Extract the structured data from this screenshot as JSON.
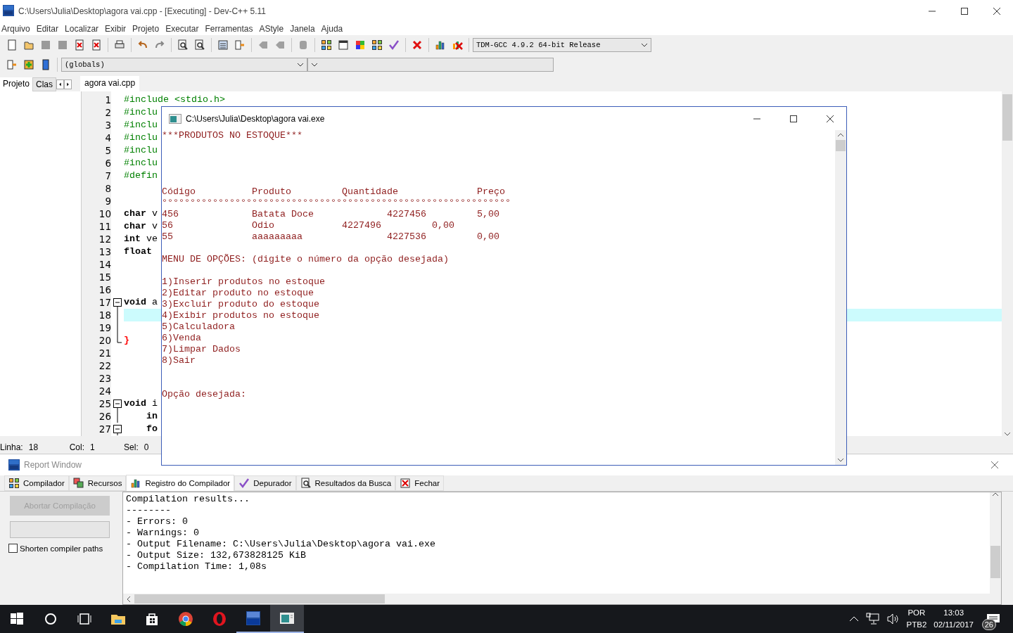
{
  "window": {
    "title": "C:\\Users\\Julia\\Desktop\\agora vai.cpp - [Executing] - Dev-C++ 5.11"
  },
  "menu": [
    "Arquivo",
    "Editar",
    "Localizar",
    "Exibir",
    "Projeto",
    "Executar",
    "Ferramentas",
    "AStyle",
    "Janela",
    "Ajuda"
  ],
  "toolbar": {
    "compiler": "TDM-GCC 4.9.2 64-bit Release",
    "scope": "(globals)"
  },
  "left_panel": {
    "tabs": [
      {
        "label": "Projeto",
        "selected": true
      },
      {
        "label": "Clas",
        "selected": false
      }
    ]
  },
  "editor": {
    "tabs": [
      {
        "label": "agora vai.cpp",
        "selected": true
      }
    ],
    "lines": [
      {
        "number": "1",
        "kind": "preprocessor",
        "text": "#include <stdio.h>",
        "current": false
      },
      {
        "number": "2",
        "kind": "preprocessor",
        "text": "#inclu",
        "current": false
      },
      {
        "number": "3",
        "kind": "preprocessor",
        "text": "#inclu",
        "current": false
      },
      {
        "number": "4",
        "kind": "preprocessor",
        "text": "#inclu",
        "current": false
      },
      {
        "number": "5",
        "kind": "preprocessor",
        "text": "#inclu",
        "current": false
      },
      {
        "number": "6",
        "kind": "preprocessor",
        "text": "#inclu",
        "current": false
      },
      {
        "number": "7",
        "kind": "preprocessor",
        "text": "#defin",
        "current": false
      },
      {
        "number": "8",
        "current": false
      },
      {
        "number": "9",
        "current": false
      },
      {
        "number": "10",
        "kind": "code",
        "text": "**char** v",
        "current": false
      },
      {
        "number": "11",
        "kind": "code",
        "text": "**char** v",
        "current": false
      },
      {
        "number": "12",
        "kind": "code",
        "text": "**int** ve",
        "current": false
      },
      {
        "number": "13",
        "kind": "keyword",
        "text": "float",
        "current": false
      },
      {
        "number": "14",
        "current": false
      },
      {
        "number": "15",
        "current": false
      },
      {
        "number": "16",
        "current": false
      },
      {
        "number": "17",
        "kind": "code",
        "text": "**void** a",
        "collapsible": true,
        "current": false
      },
      {
        "number": "18",
        "in_block": true,
        "current": true
      },
      {
        "number": "19",
        "in_block": true,
        "current": false
      },
      {
        "number": "20",
        "kind": "brace",
        "text": "}",
        "in_block": true,
        "current": false
      },
      {
        "number": "21",
        "current": false
      },
      {
        "number": "22",
        "current": false
      },
      {
        "number": "23",
        "current": false
      },
      {
        "number": "24",
        "current": false
      },
      {
        "number": "25",
        "kind": "code",
        "text": "**void** i",
        "collapsible": true,
        "current": false
      },
      {
        "number": "26",
        "kind": "keyword",
        "text": "    in",
        "in_block": true,
        "current": false
      },
      {
        "number": "27",
        "kind": "keyword",
        "text": "    fo",
        "collapsible": true,
        "current": false
      }
    ]
  },
  "status_bar": {
    "line_label": "Linha:",
    "line": "18",
    "col_label": "Col:",
    "col": "1",
    "sel_label": "Sel:",
    "sel": "0"
  },
  "console": {
    "title": "C:\\Users\\Julia\\Desktop\\agora vai.exe",
    "heading": "***PRODUTOS NO ESTOQUE***",
    "table_header": "Código          Produto         Quantidade              Preço",
    "table_rule": "°°°°°°°°°°°°°°°°°°°°°°°°°°°°°°°°°°°°°°°°°°°°°°°°°°°°°°°°°°°°°°",
    "table_rows": [
      "456             Batata Doce             4227456         5,00",
      "56              Odio            4227496         0,00",
      "55              aaaaaaaaa               4227536         0,00"
    ],
    "menu_title": "MENU DE OPÇÕES: (digite o número da opção desejada)",
    "options": [
      "1)Inserir produtos no estoque",
      "2)Editar produto no estoque",
      "3)Excluir produto do estoque",
      "4)Exibir produtos no estoque",
      "5)Calculadora",
      "6)Venda",
      "7)Limpar Dados",
      "8)Sair"
    ],
    "prompt": "Opção desejada:"
  },
  "report": {
    "title": "Report Window",
    "tabs": [
      {
        "label": "Compilador",
        "selected": false
      },
      {
        "label": "Recursos",
        "selected": false
      },
      {
        "label": "Registro do Compilador",
        "selected": true
      },
      {
        "label": "Depurador",
        "selected": false
      },
      {
        "label": "Resultados da Busca",
        "selected": false
      },
      {
        "label": "Fechar",
        "selected": false
      }
    ],
    "progress": {
      "level": 0
    },
    "abort_button": {
      "label": "Abortar Compilação",
      "disabled": true
    },
    "shorten_paths": {
      "label": "Shorten compiler paths",
      "checked": false
    },
    "log": [
      "Compilation results...",
      "--------",
      "- Errors: 0",
      "- Warnings: 0",
      "- Output Filename: C:\\Users\\Julia\\Desktop\\agora vai.exe",
      "- Output Size: 132,673828125 KiB",
      "- Compilation Time: 1,08s"
    ]
  },
  "taskbar": {
    "apps": [
      {
        "kind": "start",
        "running": false,
        "selected": false
      },
      {
        "kind": "search",
        "running": false,
        "selected": false
      },
      {
        "kind": "taskview",
        "running": false,
        "selected": false
      },
      {
        "kind": "explorer",
        "running": false,
        "selected": false
      },
      {
        "kind": "store",
        "running": false,
        "selected": false
      },
      {
        "kind": "chrome",
        "running": false,
        "selected": false
      },
      {
        "kind": "opera",
        "running": false,
        "selected": false
      },
      {
        "kind": "devcpp",
        "running": true,
        "selected": false
      },
      {
        "kind": "console",
        "running": true,
        "selected": true
      }
    ],
    "language": "POR",
    "layout": "PTB2",
    "time": "13:03",
    "date": "02/11/2017",
    "notifications": "26"
  }
}
